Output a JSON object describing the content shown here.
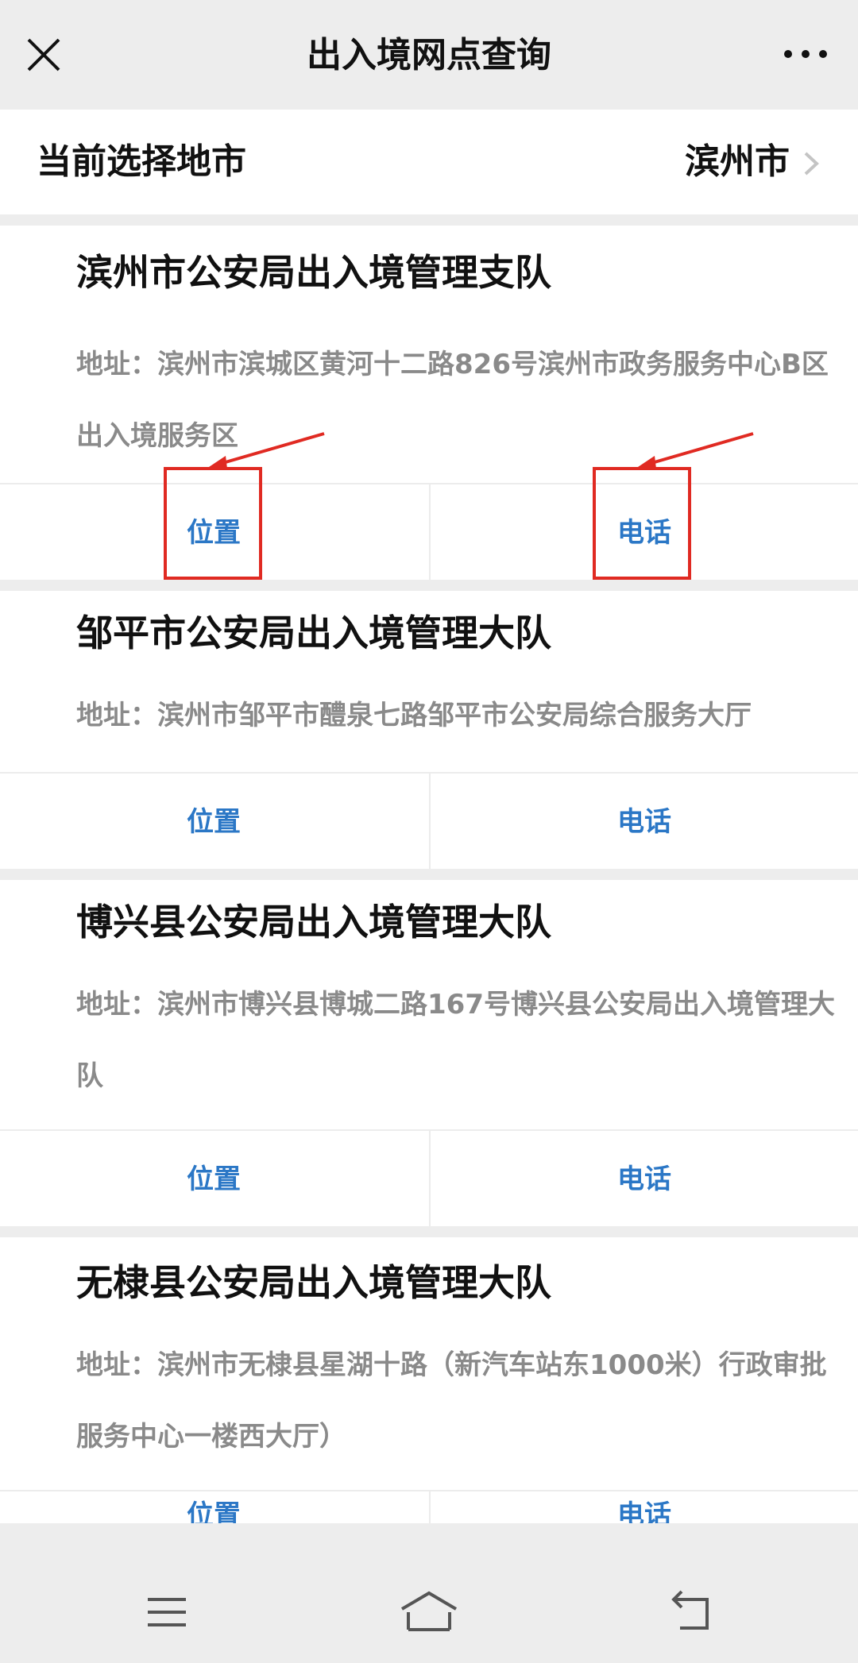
{
  "header": {
    "title": "出入境网点查询",
    "close_icon": "close-icon",
    "more_icon": "more-icon"
  },
  "city_selector": {
    "label": "当前选择地市",
    "value": "滨州市"
  },
  "offices": [
    {
      "name": "滨州市公安局出入境管理支队",
      "address": "地址：滨州市滨城区黄河十二路826号滨州市政务服务中心B区出入境服务区",
      "location_label": "位置",
      "phone_label": "电话"
    },
    {
      "name": "邹平市公安局出入境管理大队",
      "address": "地址：滨州市邹平市醴泉七路邹平市公安局综合服务大厅",
      "location_label": "位置",
      "phone_label": "电话"
    },
    {
      "name": "博兴县公安局出入境管理大队",
      "address": "地址：滨州市博兴县博城二路167号博兴县公安局出入境管理大队",
      "location_label": "位置",
      "phone_label": "电话"
    },
    {
      "name": "无棣县公安局出入境管理大队",
      "address": "地址：滨州市无棣县星湖十路（新汽车站东1000米）行政审批服务中心一楼西大厅）",
      "location_label": "位置",
      "phone_label": "电话"
    }
  ],
  "annotations": {
    "highlight_color": "#e02a22"
  },
  "colors": {
    "accent": "#2b77c6",
    "address_text": "#8a8a8a",
    "background": "#ededed"
  }
}
